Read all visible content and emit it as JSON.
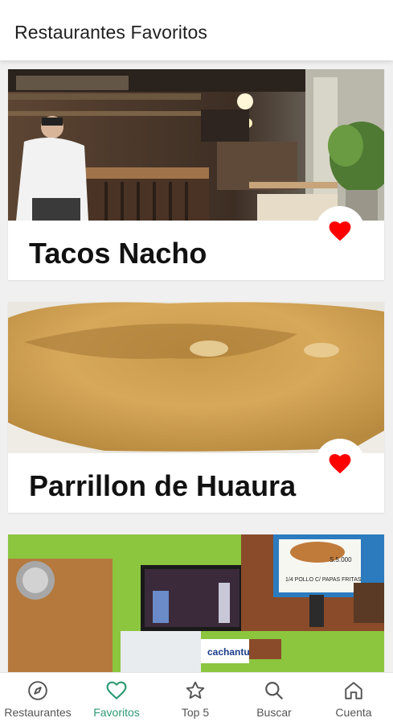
{
  "header": {
    "title": "Restaurantes Favoritos"
  },
  "restaurants": [
    {
      "name": "Tacos Nacho",
      "favorite": true,
      "image": "restaurant-interior-photo"
    },
    {
      "name": "Parrillon de Huaura",
      "favorite": true,
      "image": "empanada-photo"
    },
    {
      "name": "",
      "favorite": true,
      "image": "restaurant-wall-tv-photo",
      "sign_text": "1/4 POLLO C/ PAPAS FRITAS",
      "price_text": "S.5.000",
      "tv_brand_text": "cachantun"
    }
  ],
  "nav": {
    "active": "Favoritos",
    "items": [
      {
        "label": "Restaurantes",
        "icon": "compass-icon"
      },
      {
        "label": "Favoritos",
        "icon": "heart-icon"
      },
      {
        "label": "Top 5",
        "icon": "star-icon"
      },
      {
        "label": "Buscar",
        "icon": "search-icon"
      },
      {
        "label": "Cuenta",
        "icon": "home-icon"
      }
    ]
  },
  "colors": {
    "accent": "#2e9a73",
    "heart": "#ff0000",
    "background": "#f0f0f0"
  }
}
